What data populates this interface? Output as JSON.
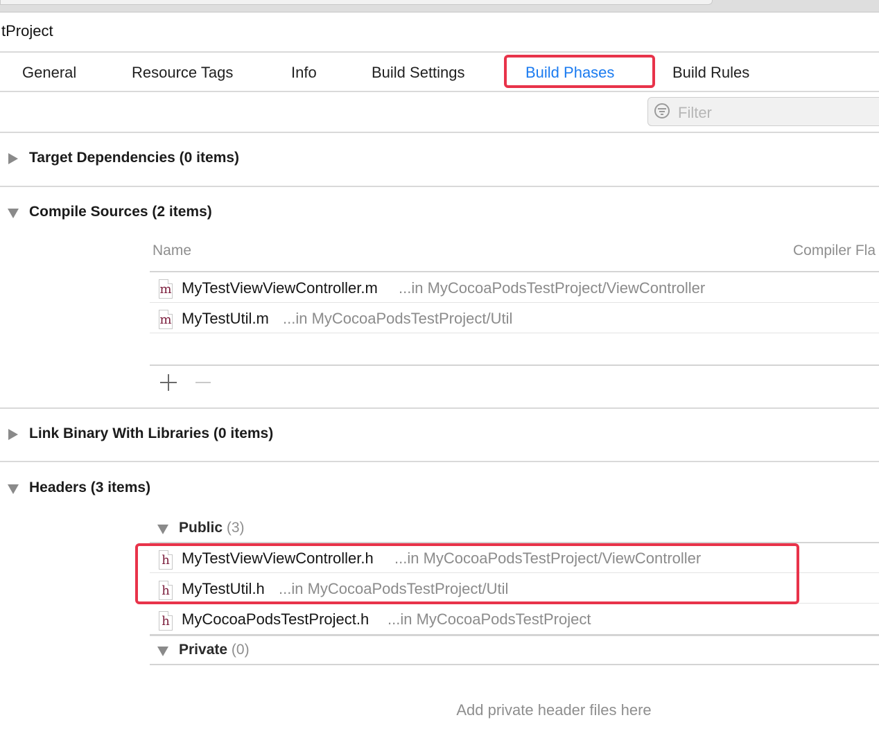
{
  "window": {
    "project_title": "tProject"
  },
  "tabs": [
    {
      "label": "General",
      "selected": false
    },
    {
      "label": "Resource Tags",
      "selected": false
    },
    {
      "label": "Info",
      "selected": false
    },
    {
      "label": "Build Settings",
      "selected": false
    },
    {
      "label": "Build Phases",
      "selected": true
    },
    {
      "label": "Build Rules",
      "selected": false
    }
  ],
  "filter": {
    "placeholder": "Filter",
    "icon": "filter-icon"
  },
  "phases": {
    "target_dependencies": {
      "title": "Target Dependencies (0 items)",
      "expanded": false
    },
    "compile_sources": {
      "title": "Compile Sources (2 items)",
      "expanded": true,
      "columns": [
        "Name",
        "Compiler Fla"
      ],
      "files": [
        {
          "icon": "m",
          "name": "MyTestViewViewController.m",
          "path": "...in MyCocoaPodsTestProject/ViewController"
        },
        {
          "icon": "m",
          "name": "MyTestUtil.m",
          "path": "...in MyCocoaPodsTestProject/Util"
        }
      ],
      "add_label": "+",
      "remove_label": "−"
    },
    "link_binary": {
      "title": "Link Binary With Libraries (0 items)",
      "expanded": false
    },
    "headers": {
      "title": "Headers (3 items)",
      "expanded": true,
      "public": {
        "label": "Public",
        "count": "(3)",
        "files": [
          {
            "icon": "h",
            "name": "MyTestViewViewController.h",
            "path": "...in MyCocoaPodsTestProject/ViewController"
          },
          {
            "icon": "h",
            "name": "MyTestUtil.h",
            "path": "...in MyCocoaPodsTestProject/Util"
          },
          {
            "icon": "h",
            "name": "MyCocoaPodsTestProject.h",
            "path": "...in MyCocoaPodsTestProject"
          }
        ]
      },
      "private": {
        "label": "Private",
        "count": "(0)",
        "empty_hint": "Add private header files here"
      }
    }
  },
  "colors": {
    "accent": "#1b7bf0",
    "highlight": "#e8334a",
    "file_icon_letter": "#7a1b3a"
  }
}
